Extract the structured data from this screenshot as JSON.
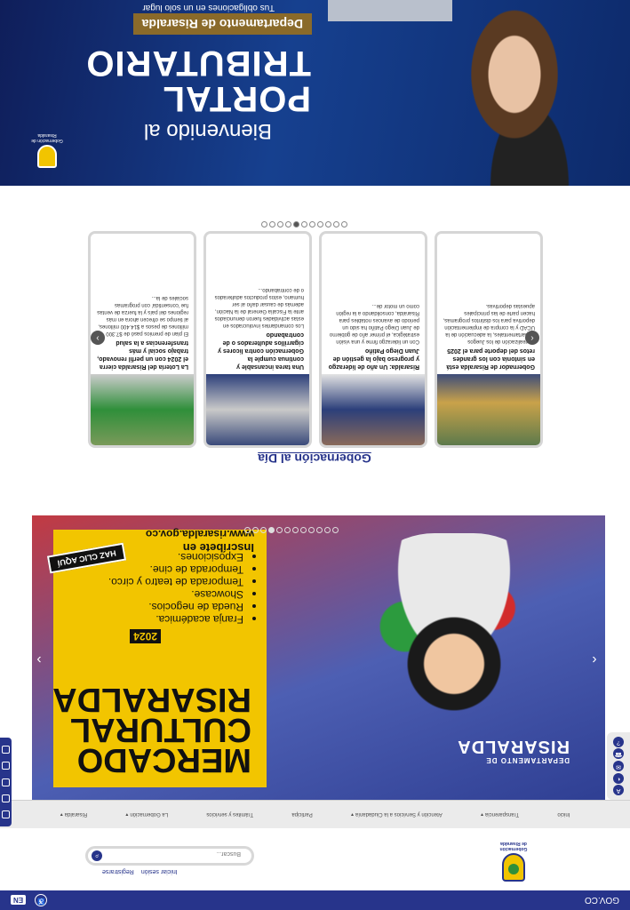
{
  "topbar": {
    "brand": "GOV.CO",
    "lang": "EN",
    "a11y_icon": "accessibility-icon"
  },
  "header": {
    "logo_text": "Gobernación de Risaralda",
    "login": "Iniciar sesión",
    "register": "Registrarse",
    "search_placeholder": "Buscar..."
  },
  "nav": {
    "items": [
      {
        "label": "Inicio"
      },
      {
        "label": "Transparencia"
      },
      {
        "label": "Atención y Servicios a la Ciudadanía"
      },
      {
        "label": "Participa"
      },
      {
        "label": "Trámites y servicios"
      },
      {
        "label": "La Gobernación"
      },
      {
        "label": "Risaralda"
      }
    ]
  },
  "banner": {
    "dept_small": "DEPARTAMENTO DE",
    "dept_big": "RISARALDA",
    "title_line1": "MERCADO",
    "title_line2": "CULTURAL",
    "title_line3": "RISARALDA",
    "year": "2024",
    "bullets": [
      "Franja académica.",
      "Rueda de negocios.",
      "Showcase.",
      "Temporada de teatro y circo.",
      "Temporada de cine.",
      "Exposiciones."
    ],
    "inscribete": "Inscríbete en",
    "url": "www.risaralda.gov.co",
    "cta": "HAZ CLIC AQUÍ"
  },
  "news": {
    "title": "Gobernación al Día",
    "cards": [
      {
        "title": "Gobernador de Risaralda está en sintonía con los grandes retos del deporte para el 2025",
        "text": "La realización de los Juegos Departamentales, la adecuación de la UCAD y la compra de implementación deportiva para los distintos programas, hacen parte de las principales apuestas deportivas."
      },
      {
        "title": "Risaralda: Un año de liderazgo y progreso bajo la gestión de Juan Diego Patiño",
        "text": "Con un liderazgo firme y una visión estratégica, el primer año de gobierno de Juan Diego Patiño ha sido un periodo de avances notables para Risaralda, consolidando a la región como un motor de..."
      },
      {
        "title": "Una tarea incansable y continua cumple la Gobernación contra licores y cigarrillos adulterados o de contrabando",
        "text": "Los comandantes involucrados en estas actividades fueron denunciados ante la Fiscalía General de la Nación, además de causar daño al ser humano, estos productos adulterados o de contrabando..."
      },
      {
        "title": "La Lotería del Risaralda cierra el 2024 con un perfil renovado, trabajo social y más transferencias a la salud",
        "text": "El plan de premios pasó de $7.300 millones de pesos a $14.400 millones, al tiempo se ofrecen ahora en más regiones del país y la fuerza de ventas fue 'consentida' con programas sociales de la..."
      }
    ]
  },
  "portal": {
    "welcome": "Bienvenido al",
    "title_line1": "PORTAL",
    "title_line2": "TRIBUTARIO",
    "dept": "Departamento de Risaralda",
    "sub": "Tus obligaciones en un solo lugar"
  },
  "colors": {
    "primary": "#27348b",
    "accent_yellow": "#f2c500"
  }
}
